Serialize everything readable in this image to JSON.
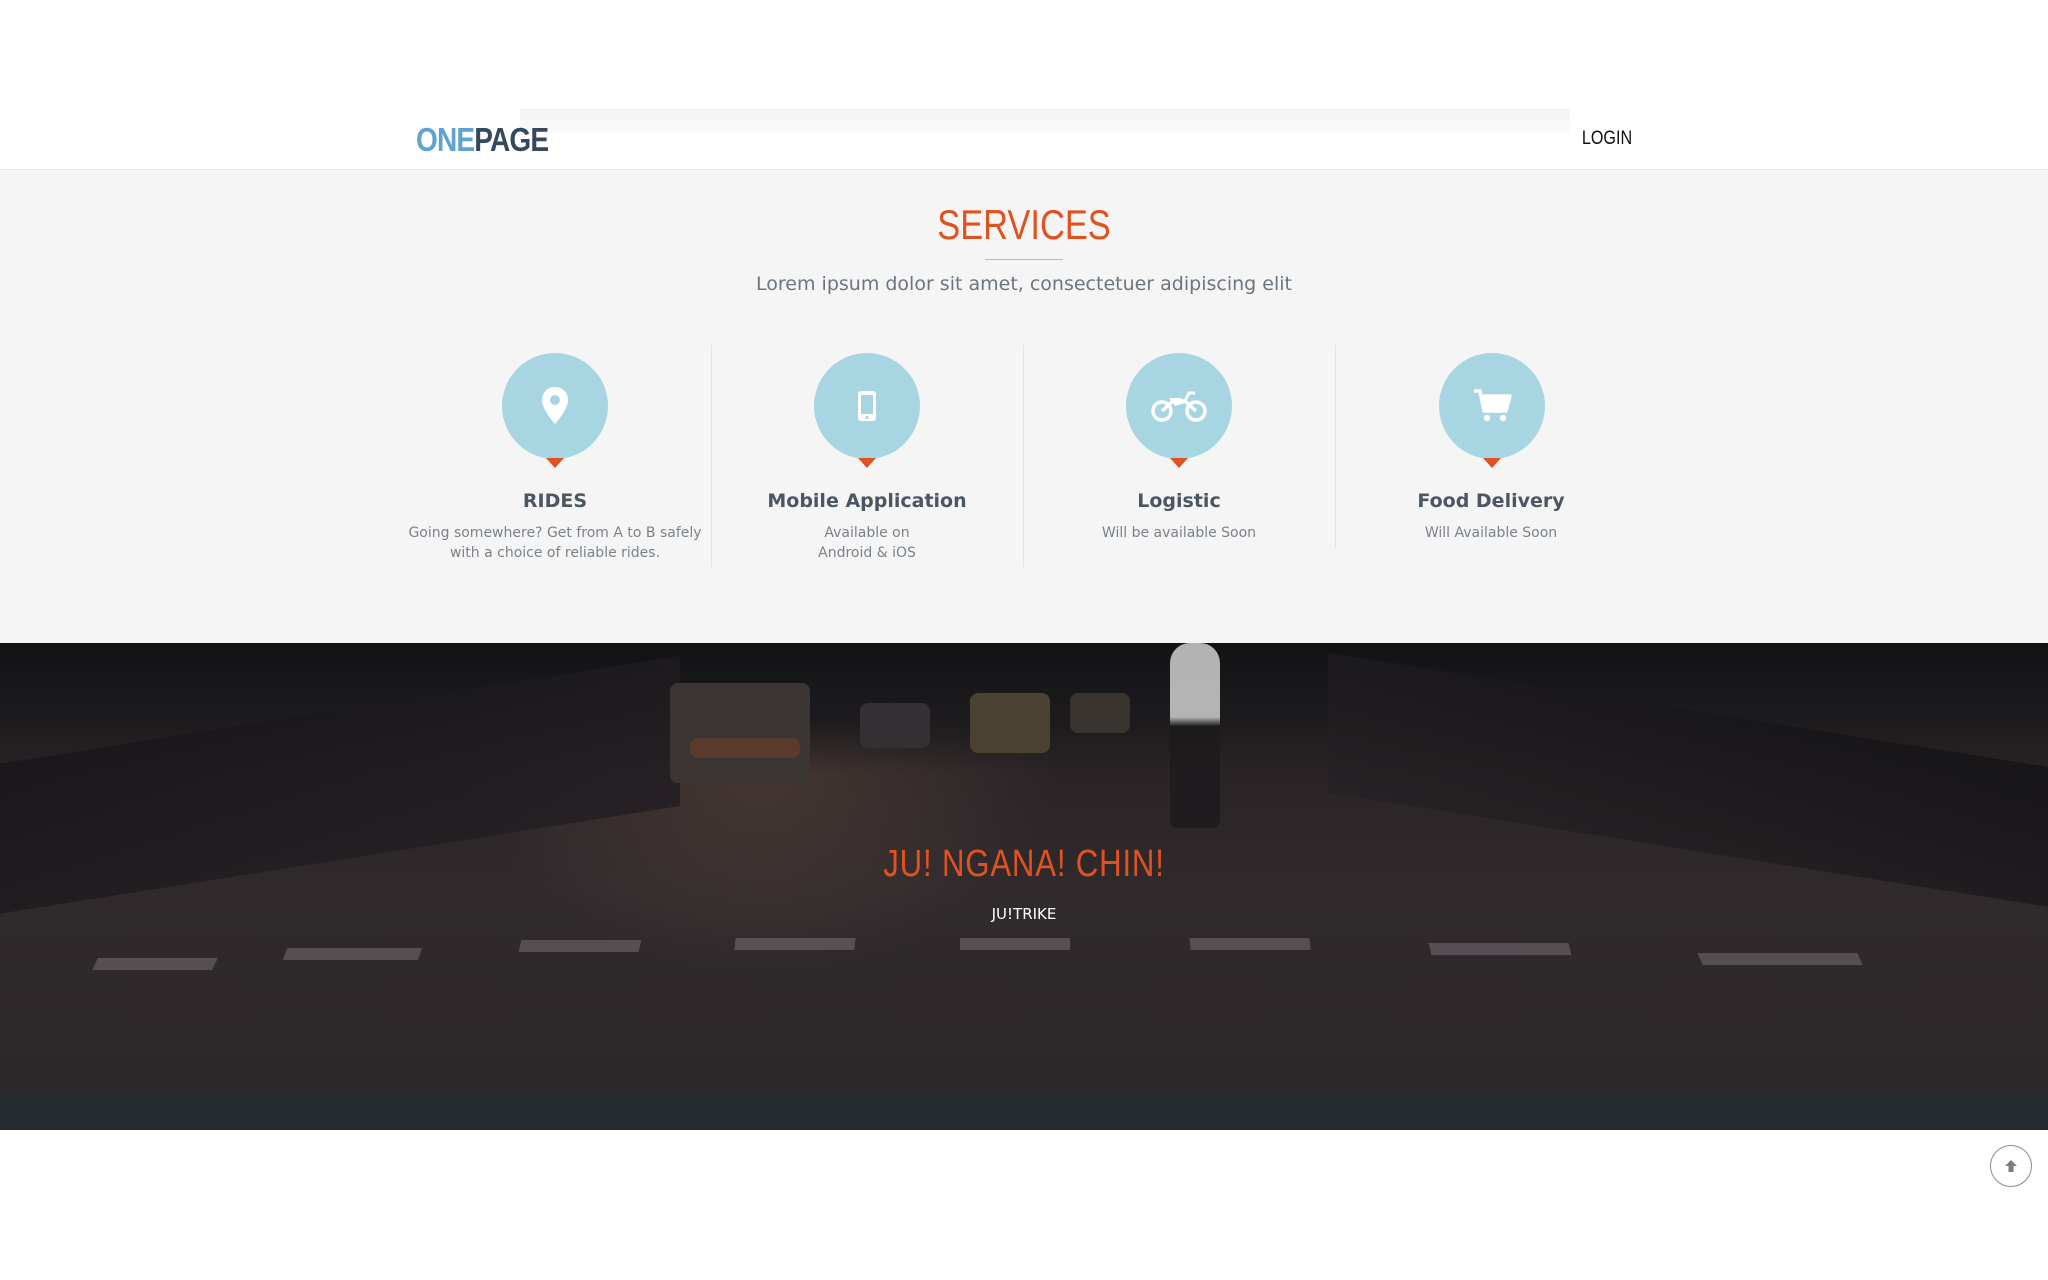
{
  "nav": {
    "logo_one": "ONE",
    "logo_page": "PAGE",
    "login_label": "LOGIN"
  },
  "services": {
    "title": "SERVICES",
    "subtitle": "Lorem ipsum dolor sit amet, consectetuer adipiscing elit",
    "items": [
      {
        "name": "RIDES",
        "desc_line1": "Going somewhere? Get from A to B safely",
        "desc_line2": "with a choice of reliable rides.",
        "icon": "map-pin-icon"
      },
      {
        "name": "Mobile Application",
        "desc_line1": "Available on",
        "desc_line2": "Android & iOS",
        "icon": "mobile-phone-icon"
      },
      {
        "name": "Logistic",
        "desc_line1": "Will be available Soon",
        "desc_line2": "",
        "icon": "motorcycle-icon"
      },
      {
        "name": "Food Delivery",
        "desc_line1": "Will Available Soon",
        "desc_line2": "",
        "icon": "shopping-cart-icon"
      }
    ]
  },
  "banner": {
    "title": "JU! NGANA! CHIN!",
    "subtitle": "JU!TRIKE"
  },
  "colors": {
    "accent": "#e0521f",
    "logo_blue": "#5fa3d0",
    "logo_dark": "#34495e",
    "icon_circle": "#a8d5e2",
    "footer": "#252b2e"
  }
}
